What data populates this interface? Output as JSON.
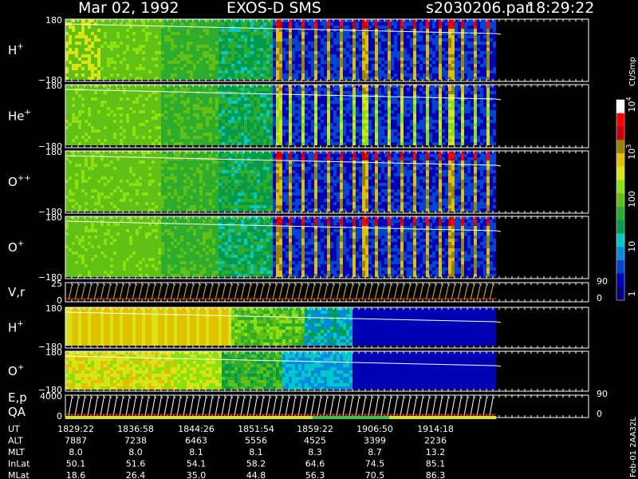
{
  "header": {
    "date": "Mar 02, 1992",
    "instrument": "EXOS-D SMS",
    "file": "s2030206.par",
    "time": "18:29:22"
  },
  "colorbar": {
    "unit": "Ct/Smp",
    "ticks": [
      {
        "label": "1",
        "value": 1
      },
      {
        "label": "10",
        "value": 10
      },
      {
        "label": "100",
        "value": 100
      },
      {
        "label": "10",
        "sup": "3",
        "value": 1000
      },
      {
        "label": "10",
        "sup": "4",
        "value": 10000
      }
    ],
    "colors": [
      "#00007c",
      "#0000b4",
      "#0044d4",
      "#008cdc",
      "#00c8c8",
      "#009c4c",
      "#2eac2e",
      "#60c014",
      "#8ce010",
      "#d8e414",
      "#e0c000",
      "#9c8400",
      "#c80000",
      "#ff0000",
      "#ffffff"
    ]
  },
  "footer_id": "Feb-01 2AA32L",
  "chart_data": {
    "type": "heatmap",
    "x_axis": {
      "label": "UT",
      "ticks": [
        "1829:22",
        "1836:58",
        "1844:26",
        "1851:54",
        "1859:22",
        "1906:50",
        "1914:18"
      ]
    },
    "ephemeris": [
      {
        "label": "UT",
        "values": [
          "1829:22",
          "1836:58",
          "1844:26",
          "1851:54",
          "1859:22",
          "1906:50",
          "1914:18"
        ]
      },
      {
        "label": "ALT",
        "values": [
          "7887",
          "7238",
          "6463",
          "5556",
          "4525",
          "3399",
          "2236"
        ]
      },
      {
        "label": "MLT",
        "values": [
          "8.0",
          "8.0",
          "8.1",
          "8.1",
          "8.3",
          "8.7",
          "13.2"
        ]
      },
      {
        "label": "InLat",
        "values": [
          "50.1",
          "51.6",
          "54.1",
          "58.2",
          "64.6",
          "74.5",
          "85.1"
        ]
      },
      {
        "label": "MLat",
        "values": [
          "18.6",
          "26.4",
          "35.0",
          "44.8",
          "56.3",
          "70.5",
          "86.3"
        ]
      }
    ],
    "panels": [
      {
        "id": "h-plus",
        "label": "H",
        "sup": "+",
        "y_ticks": [
          "180",
          "−180"
        ],
        "profile": "p1"
      },
      {
        "id": "he-plus",
        "label": "He",
        "sup": "+",
        "y_ticks": [
          "180",
          "−180"
        ],
        "profile": "p2"
      },
      {
        "id": "o-plusplus",
        "label": "O",
        "sup": "++",
        "y_ticks": [
          "180",
          "−180"
        ],
        "profile": "p3"
      },
      {
        "id": "o-plus",
        "label": "O",
        "sup": "+",
        "y_ticks": [
          "180",
          "−180"
        ],
        "profile": "p4"
      },
      {
        "id": "vr",
        "label": "V,r",
        "y_ticks": [
          "25",
          "0"
        ],
        "right_ticks": [
          "90",
          "0"
        ],
        "line": true
      },
      {
        "id": "h-plus-2",
        "label": "H",
        "sup": "+",
        "y_ticks": [
          "180",
          "−180"
        ],
        "profile": "p6"
      },
      {
        "id": "o-plus-2",
        "label": "O",
        "sup": "+",
        "y_ticks": [
          "180",
          "−180"
        ],
        "profile": "p7"
      },
      {
        "id": "ep",
        "label": "E,p",
        "label2": "QA",
        "y_ticks": [
          "4000",
          "0"
        ],
        "right_ticks": [
          "90",
          "0"
        ],
        "line": true
      }
    ]
  }
}
